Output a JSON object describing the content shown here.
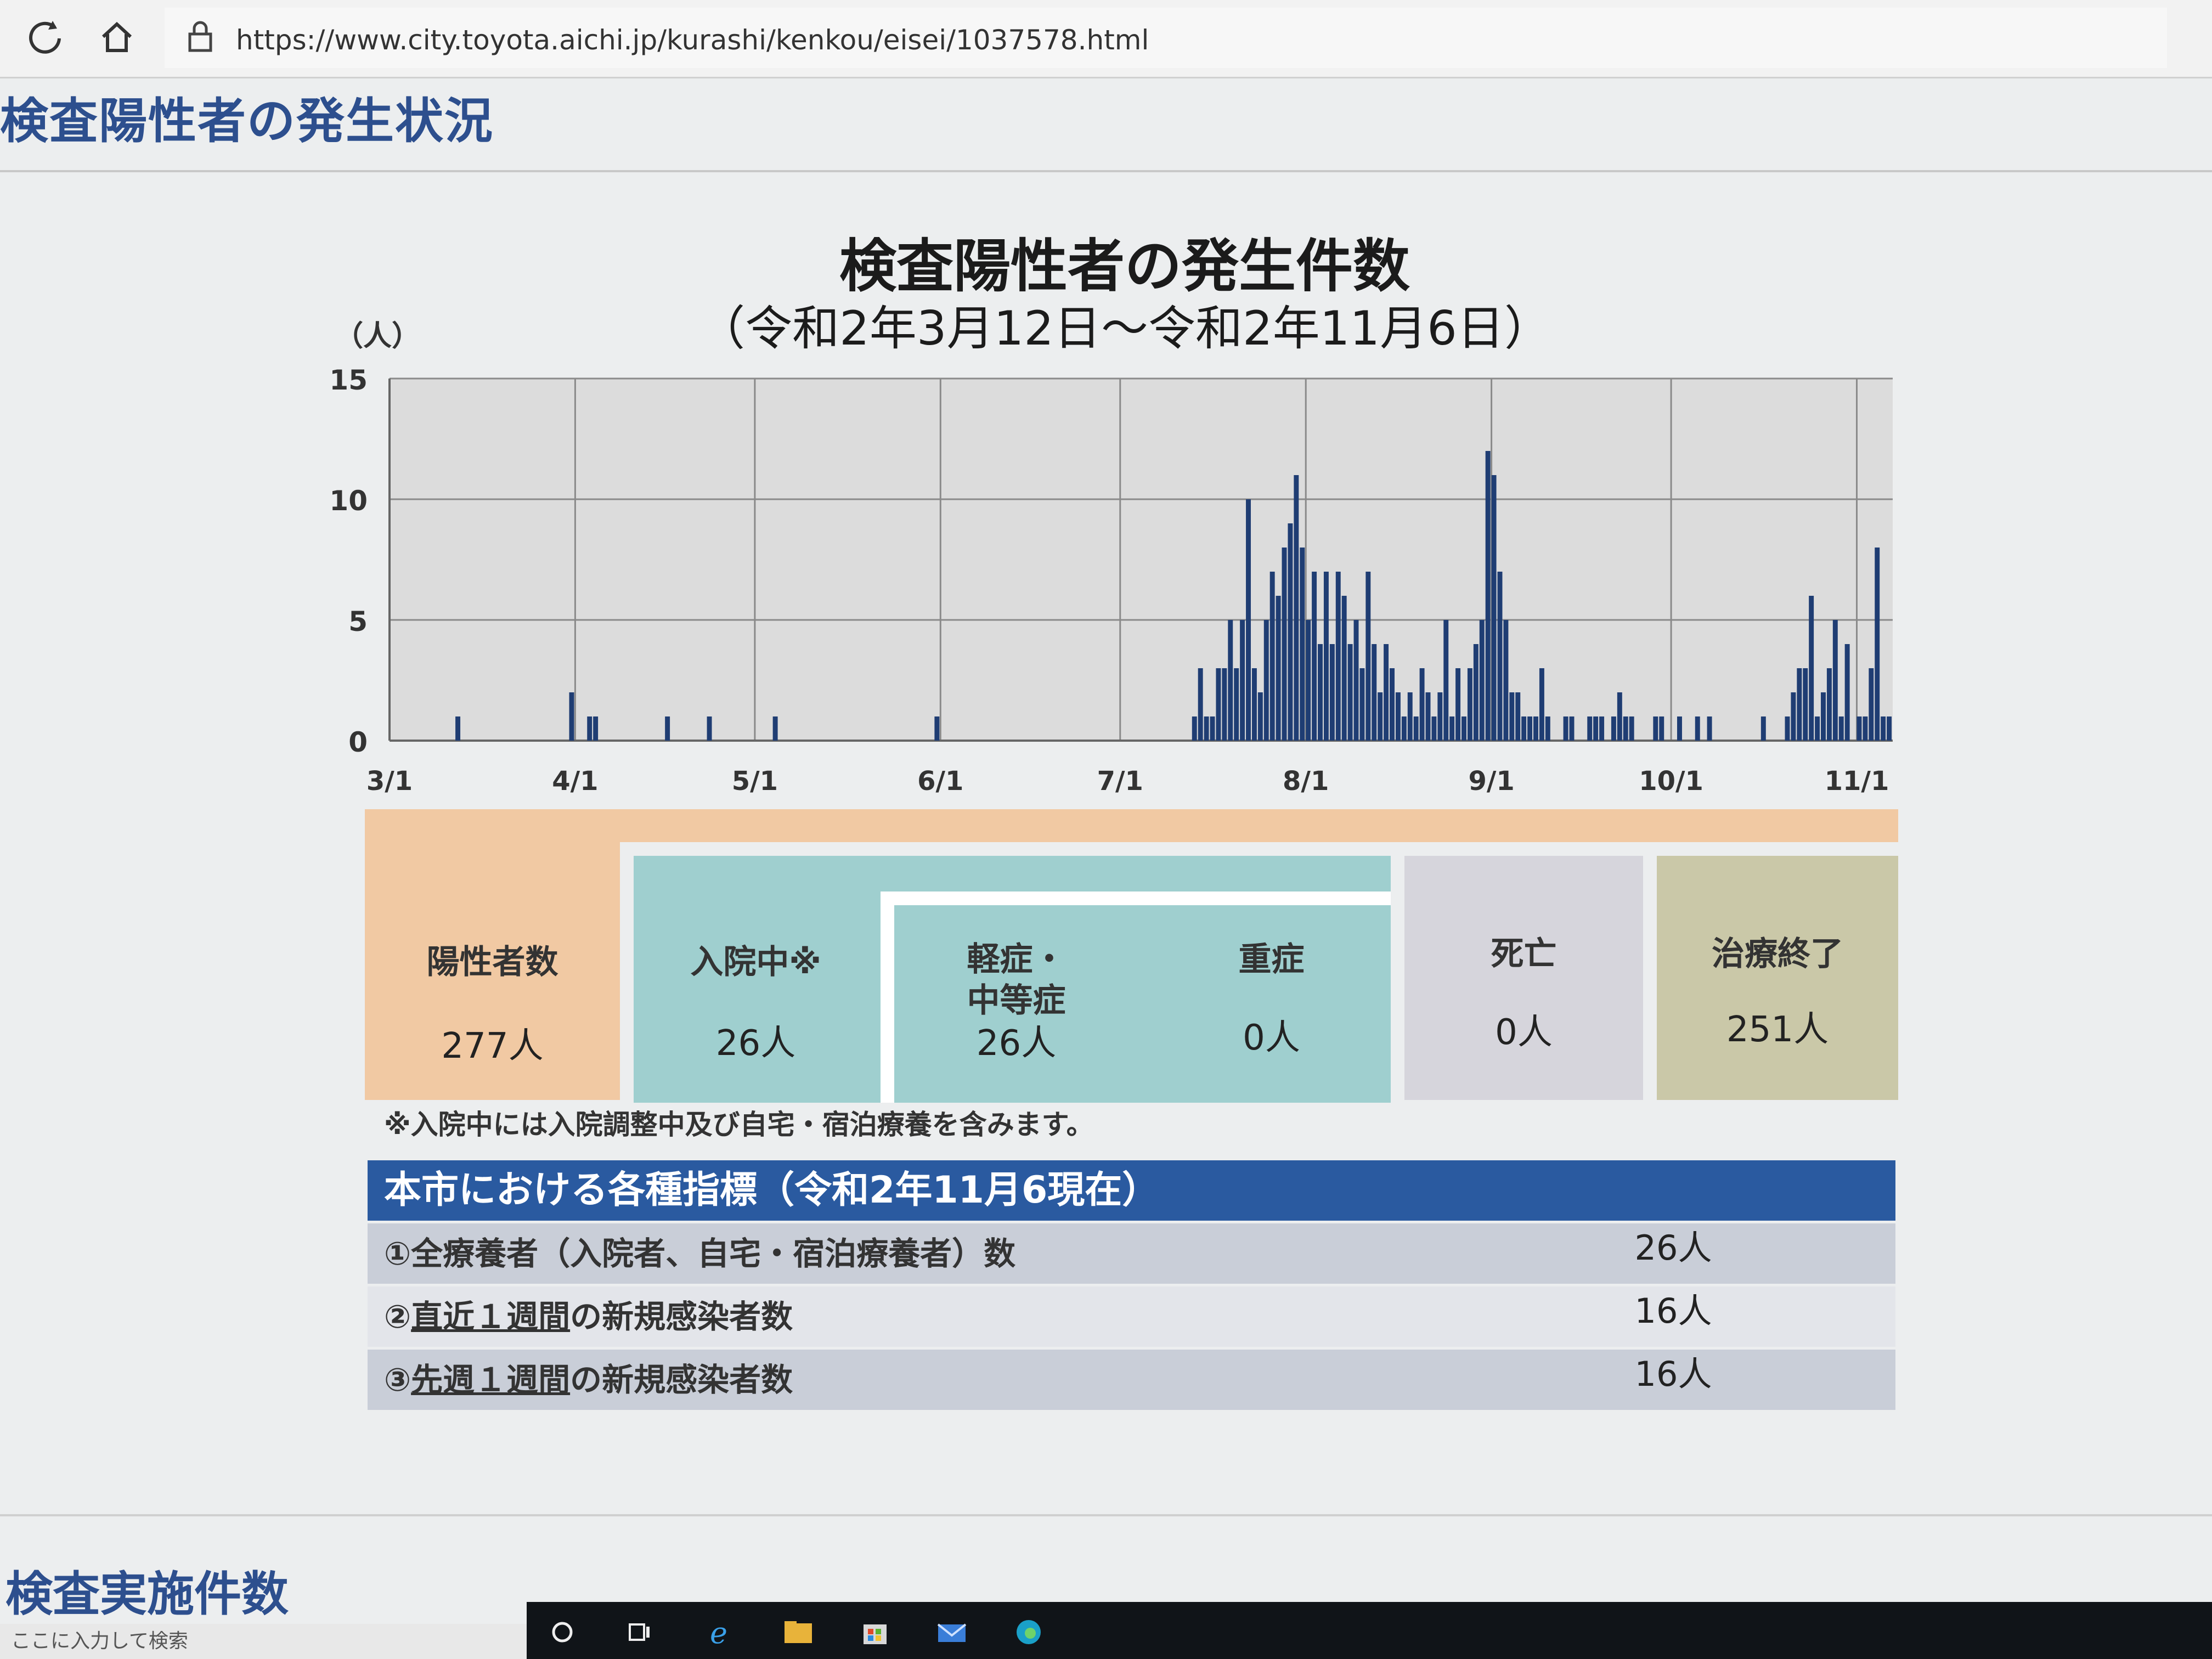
{
  "browser": {
    "url": "https://www.city.toyota.aichi.jp/kurashi/kenkou/eisei/1037578.html",
    "icons": [
      "refresh-icon",
      "home-icon",
      "lock-icon"
    ]
  },
  "page": {
    "section_title": "検査陽性者の発生状況",
    "next_section_title": "検査実施件数"
  },
  "chart_data": {
    "type": "bar",
    "title": "検査陽性者の発生件数",
    "subtitle": "（令和2年3月12日～令和2年11月6日）",
    "ylabel": "（人）",
    "ylim": [
      0,
      15
    ],
    "yticks": [
      0,
      5,
      10,
      15
    ],
    "xtick_labels": [
      "3/1",
      "4/1",
      "5/1",
      "6/1",
      "7/1",
      "8/1",
      "9/1",
      "10/1",
      "11/1"
    ],
    "xtick_dates": [
      "2020-03-01",
      "2020-04-01",
      "2020-05-01",
      "2020-06-01",
      "2020-07-01",
      "2020-08-01",
      "2020-09-01",
      "2020-10-01",
      "2020-11-01"
    ],
    "xlim": [
      "2020-03-01",
      "2020-11-06"
    ],
    "grid": true,
    "bar_color": "#1f3d73",
    "dates": [
      "2020-03-12",
      "2020-03-31",
      "2020-04-03",
      "2020-04-04",
      "2020-04-16",
      "2020-04-23",
      "2020-05-04",
      "2020-05-31",
      "2020-07-13",
      "2020-07-14",
      "2020-07-15",
      "2020-07-16",
      "2020-07-17",
      "2020-07-18",
      "2020-07-19",
      "2020-07-20",
      "2020-07-21",
      "2020-07-22",
      "2020-07-23",
      "2020-07-24",
      "2020-07-25",
      "2020-07-26",
      "2020-07-27",
      "2020-07-28",
      "2020-07-29",
      "2020-07-30",
      "2020-07-31",
      "2020-08-01",
      "2020-08-02",
      "2020-08-03",
      "2020-08-04",
      "2020-08-05",
      "2020-08-06",
      "2020-08-07",
      "2020-08-08",
      "2020-08-09",
      "2020-08-10",
      "2020-08-11",
      "2020-08-12",
      "2020-08-13",
      "2020-08-14",
      "2020-08-15",
      "2020-08-16",
      "2020-08-17",
      "2020-08-18",
      "2020-08-19",
      "2020-08-20",
      "2020-08-21",
      "2020-08-22",
      "2020-08-23",
      "2020-08-24",
      "2020-08-25",
      "2020-08-26",
      "2020-08-27",
      "2020-08-28",
      "2020-08-29",
      "2020-08-30",
      "2020-08-31",
      "2020-09-01",
      "2020-09-02",
      "2020-09-03",
      "2020-09-04",
      "2020-09-05",
      "2020-09-06",
      "2020-09-07",
      "2020-09-08",
      "2020-09-09",
      "2020-09-10",
      "2020-09-13",
      "2020-09-14",
      "2020-09-17",
      "2020-09-18",
      "2020-09-19",
      "2020-09-21",
      "2020-09-22",
      "2020-09-23",
      "2020-09-24",
      "2020-09-28",
      "2020-09-29",
      "2020-10-02",
      "2020-10-05",
      "2020-10-07",
      "2020-10-16",
      "2020-10-20",
      "2020-10-21",
      "2020-10-22",
      "2020-10-23",
      "2020-10-24",
      "2020-10-25",
      "2020-10-26",
      "2020-10-27",
      "2020-10-28",
      "2020-10-29",
      "2020-10-30",
      "2020-11-01",
      "2020-11-02",
      "2020-11-03",
      "2020-11-04",
      "2020-11-05",
      "2020-11-06"
    ],
    "values": [
      1,
      2,
      1,
      1,
      1,
      1,
      1,
      1,
      1,
      3,
      1,
      1,
      3,
      3,
      5,
      3,
      5,
      10,
      3,
      2,
      5,
      7,
      6,
      8,
      9,
      11,
      8,
      5,
      7,
      4,
      7,
      4,
      7,
      6,
      4,
      5,
      3,
      7,
      4,
      2,
      4,
      3,
      2,
      1,
      2,
      1,
      3,
      2,
      1,
      2,
      5,
      1,
      3,
      1,
      3,
      4,
      5,
      12,
      11,
      7,
      5,
      2,
      2,
      1,
      1,
      1,
      3,
      1,
      1,
      1,
      1,
      1,
      1,
      1,
      2,
      1,
      1,
      1,
      1,
      1,
      1,
      1,
      1,
      1,
      2,
      3,
      3,
      6,
      1,
      2,
      3,
      5,
      1,
      4,
      1,
      1,
      3,
      8,
      1,
      1
    ]
  },
  "status": {
    "positive": {
      "label": "陽性者数",
      "value": "277人"
    },
    "hospitalized": {
      "label": "入院中※",
      "value": "26人"
    },
    "mild": {
      "label_line1": "軽症・",
      "label_line2": "中等症",
      "value": "26人"
    },
    "severe": {
      "label": "重症",
      "value": "0人"
    },
    "death": {
      "label": "死亡",
      "value": "0人"
    },
    "recovered": {
      "label": "治療終了",
      "value": "251人"
    },
    "note": "※入院中には入院調整中及び自宅・宿泊療養を含みます。"
  },
  "indicators": {
    "header": "本市における各種指標（令和2年11月6現在）",
    "rows": [
      {
        "label": "①全療養者（入院者、自宅・宿泊療養者）数",
        "value": "26人"
      },
      {
        "label_prefix": "②",
        "label_link": "直近１週間",
        "label_suffix": "の新規感染者数",
        "value": "16人"
      },
      {
        "label_prefix": "③",
        "label_link": "先週１週間",
        "label_suffix": "の新規感染者数",
        "value": "16人"
      }
    ]
  },
  "taskbar": {
    "search_placeholder": "ここに入力して検索",
    "icons": [
      "cortana-icon",
      "task-view-icon",
      "ie-icon",
      "file-explorer-icon",
      "store-icon",
      "mail-icon",
      "edge-icon"
    ]
  }
}
